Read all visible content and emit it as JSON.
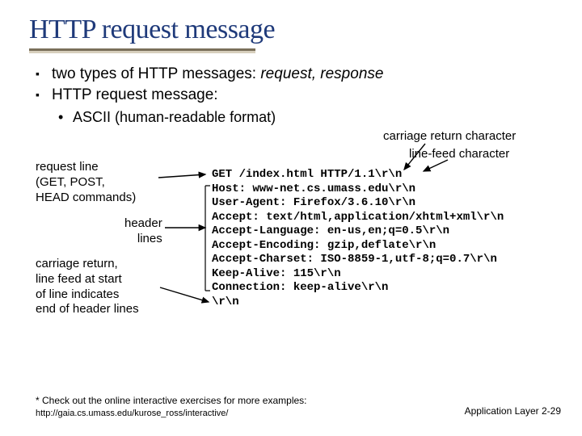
{
  "title": "HTTP request message",
  "bullets": {
    "b1a_prefix": "two types of HTTP messages: ",
    "b1a_italic": "request, response",
    "b1b": "HTTP request message:",
    "b2": "ASCII (human-readable format)"
  },
  "labels": {
    "carriage_return": "carriage return character",
    "line_feed": "line-feed character",
    "request_line": "request line\n(GET, POST,\nHEAD commands)",
    "header_lines": "header\nlines",
    "end_headers": "carriage return,\nline feed at start\nof line indicates\nend of header lines"
  },
  "code_lines": [
    "GET /index.html HTTP/1.1\\r\\n",
    "Host: www-net.cs.umass.edu\\r\\n",
    "User-Agent: Firefox/3.6.10\\r\\n",
    "Accept: text/html,application/xhtml+xml\\r\\n",
    "Accept-Language: en-us,en;q=0.5\\r\\n",
    "Accept-Encoding: gzip,deflate\\r\\n",
    "Accept-Charset: ISO-8859-1,utf-8;q=0.7\\r\\n",
    "Keep-Alive: 115\\r\\n",
    "Connection: keep-alive\\r\\n",
    "\\r\\n"
  ],
  "footnote": {
    "text": "* Check out the online interactive exercises for more examples: ",
    "url": "http://gaia.cs.umass.edu/kurose_ross/interactive/"
  },
  "pagenum": {
    "section": "Application Layer",
    "page": "2-29"
  }
}
